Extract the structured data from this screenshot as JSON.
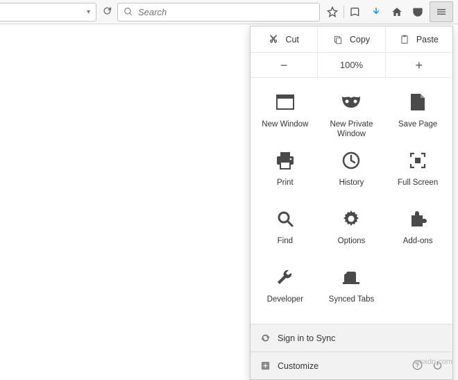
{
  "toolbar": {
    "search_placeholder": "Search"
  },
  "edit": {
    "cut": "Cut",
    "copy": "Copy",
    "paste": "Paste"
  },
  "zoom": {
    "level": "100%"
  },
  "grid": {
    "new_window": "New Window",
    "new_private": "New Private Window",
    "save_page": "Save Page",
    "print": "Print",
    "history": "History",
    "full_screen": "Full Screen",
    "find": "Find",
    "options": "Options",
    "addons": "Add-ons",
    "developer": "Developer",
    "synced_tabs": "Synced Tabs"
  },
  "footer": {
    "sign_in": "Sign in to Sync",
    "customize": "Customize"
  },
  "watermark": "wsxdn.com"
}
